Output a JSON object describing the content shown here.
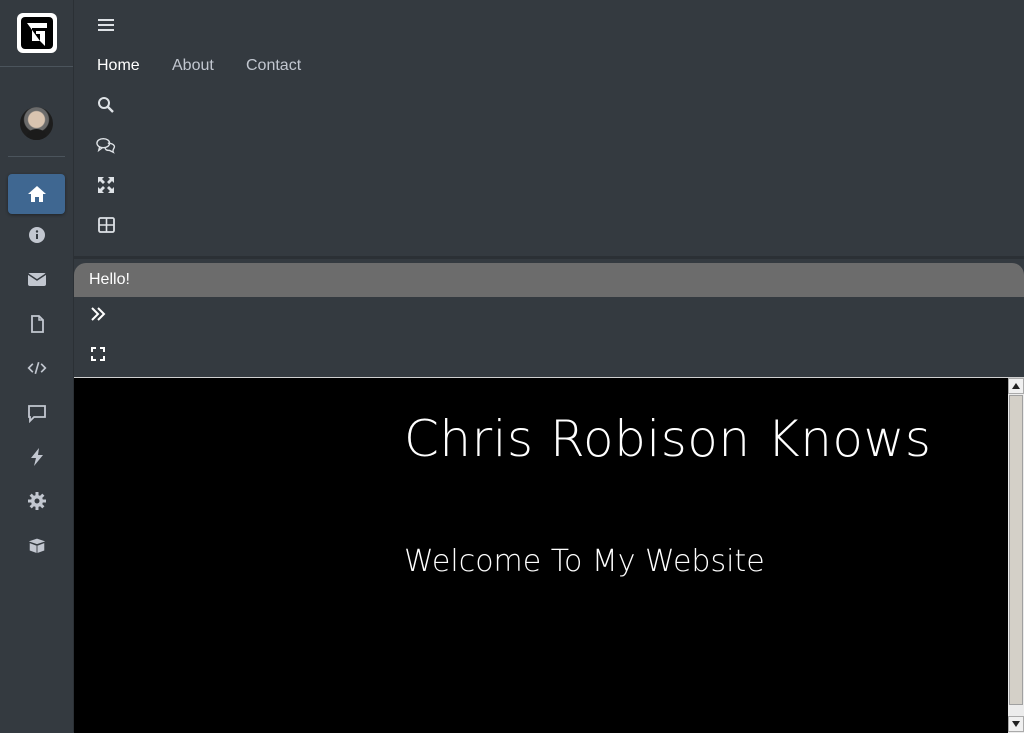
{
  "sidebar": {
    "items": [
      {
        "icon": "home-icon",
        "active": true
      },
      {
        "icon": "info-icon",
        "active": false
      },
      {
        "icon": "envelope-icon",
        "active": false
      },
      {
        "icon": "file-icon",
        "active": false
      },
      {
        "icon": "code-icon",
        "active": false
      },
      {
        "icon": "comment-icon",
        "active": false
      },
      {
        "icon": "bolt-icon",
        "active": false
      },
      {
        "icon": "gear-icon",
        "active": false
      },
      {
        "icon": "box-open-icon",
        "active": false
      }
    ]
  },
  "topnav": {
    "links": [
      {
        "label": "Home",
        "active": true
      },
      {
        "label": "About",
        "active": false
      },
      {
        "label": "Contact",
        "active": false
      }
    ],
    "icons": [
      "hamburger-icon",
      "search-icon",
      "comments-icon",
      "expand-arrows-icon",
      "table-icon"
    ]
  },
  "tabs": {
    "active_label": "Hello!"
  },
  "content": {
    "title": "Chris Robison Knows",
    "subtitle": "Welcome To My Website"
  },
  "colors": {
    "sidebar_bg": "#343a40",
    "active_item": "#3f6791",
    "tab_bg": "#6c6c6c",
    "content_bg": "#000000"
  }
}
